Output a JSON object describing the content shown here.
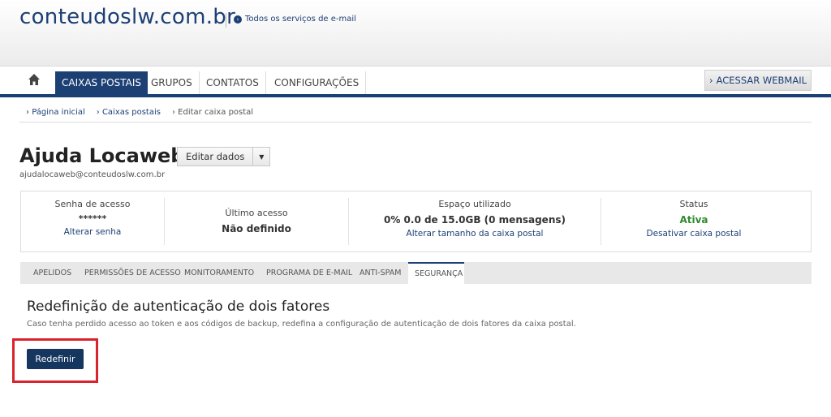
{
  "header": {
    "domain": "conteudoslw.com.br",
    "services_link": "Todos os serviços de e-mail"
  },
  "nav": {
    "items": [
      {
        "label": "CAIXAS POSTAIS"
      },
      {
        "label": "GRUPOS"
      },
      {
        "label": "CONTATOS"
      },
      {
        "label": "CONFIGURAÇÕES"
      }
    ],
    "webmail": "ACESSAR WEBMAIL"
  },
  "breadcrumb": [
    "Página inicial",
    "Caixas postais",
    "Editar caixa postal"
  ],
  "user": {
    "name": "Ajuda Locaweb",
    "email": "ajudalocaweb@conteudoslw.com.br",
    "edit_label": "Editar dados"
  },
  "info": {
    "password": {
      "label": "Senha de acesso",
      "value": "******",
      "link": "Alterar senha"
    },
    "last_access": {
      "label": "Último acesso",
      "value": "Não definido"
    },
    "space": {
      "label": "Espaço utilizado",
      "value": "0% 0.0 de 15.0GB (0 mensagens)",
      "link": "Alterar tamanho da caixa postal"
    },
    "status": {
      "label": "Status",
      "value": "Ativa",
      "link": "Desativar caixa postal",
      "value_color": "#2e8b2e"
    }
  },
  "tabs": [
    {
      "label": "APELIDOS"
    },
    {
      "label": "PERMISSÕES DE ACESSO"
    },
    {
      "label": "MONITORAMENTO"
    },
    {
      "label": "PROGRAMA DE E-MAIL"
    },
    {
      "label": "ANTI-SPAM"
    },
    {
      "label": "SEGURANÇA"
    }
  ],
  "security": {
    "title": "Redefinição de autenticação de dois fatores",
    "description": "Caso tenha perdido acesso ao token e aos códigos de backup, redefina a configuração de autenticação de dois fatores da caixa postal.",
    "button": "Redefinir"
  },
  "colors": {
    "brand": "#1c3f74",
    "highlight": "#d9232d",
    "button": "#15365f"
  }
}
